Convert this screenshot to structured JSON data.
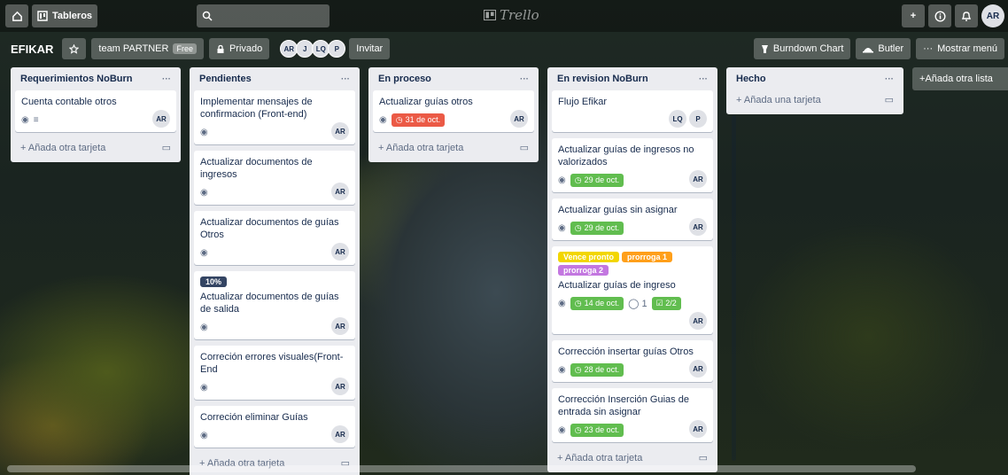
{
  "topbar": {
    "home_icon": "home-icon",
    "boards_label": "Tableros",
    "search_icon": "search-icon",
    "logo_text": "Trello",
    "buttons": [
      "+",
      "ⓘ",
      "🔔"
    ],
    "user_initials": "AR"
  },
  "boardbar": {
    "title": "EFIKAR",
    "team_label": "team PARTNER",
    "free_badge": "Free",
    "privacy_label": "Privado",
    "members": [
      "AR",
      "J",
      "LQ",
      "P"
    ],
    "invite_label": "Invitar",
    "burndown_label": "Burndown Chart",
    "butler_label": "Butler",
    "menu_label": "Mostrar menú"
  },
  "add_card_label": "Añada otra tarjeta",
  "add_card_label_alt": "Añada una tarjeta",
  "add_list_label": "Añada otra lista",
  "lists": [
    {
      "title": "Requerimientos NoBurn",
      "cards": [
        {
          "title": "Cuenta contable otros",
          "members": [
            "AR"
          ],
          "watch": true,
          "desc": true
        }
      ]
    },
    {
      "title": "Pendientes",
      "cards": [
        {
          "title": "Implementar mensajes de confirmacion (Front-end)",
          "members": [
            "AR"
          ],
          "watch": true
        },
        {
          "title": "Actualizar documentos de ingresos",
          "members": [
            "AR"
          ],
          "watch": true
        },
        {
          "title": "Actualizar documentos de guías Otros",
          "members": [
            "AR"
          ],
          "watch": true
        },
        {
          "title": "Actualizar documentos de guías de salida",
          "members": [
            "AR"
          ],
          "watch": true,
          "label": "10%"
        },
        {
          "title": "Correción errores visuales(Front-End",
          "members": [
            "AR"
          ],
          "watch": true
        },
        {
          "title": "Correción eliminar Guías",
          "members": [
            "AR"
          ],
          "watch": true
        }
      ]
    },
    {
      "title": "En proceso",
      "cards": [
        {
          "title": "Actualizar guías otros",
          "members": [
            "AR"
          ],
          "watch": true,
          "due": "31 de oct.",
          "due_color": "#eb5a46"
        }
      ]
    },
    {
      "title": "En revision NoBurn",
      "cards": [
        {
          "title": "Flujo Efikar",
          "members": [
            "LQ",
            "P"
          ]
        },
        {
          "title": "Actualizar guías de ingresos no valorizados",
          "members": [
            "AR"
          ],
          "watch": true,
          "due": "29 de oct."
        },
        {
          "title": "Actualizar guías sin asignar",
          "members": [
            "AR"
          ],
          "watch": true,
          "due": "29 de oct."
        },
        {
          "title": "Actualizar guías de ingreso",
          "members": [
            "AR"
          ],
          "watch": true,
          "due": "14 de oct.",
          "comments": "1",
          "checklist": "2/2",
          "labels": [
            {
              "text": "Vence pronto",
              "color": "#f2d600"
            },
            {
              "text": "prorroga 1",
              "color": "#ff9f1a"
            },
            {
              "text": "prorroga 2",
              "color": "#c377e0"
            }
          ]
        },
        {
          "title": "Corrección insertar guías Otros",
          "members": [
            "AR"
          ],
          "watch": true,
          "due": "28 de oct."
        },
        {
          "title": "Corrección Inserción Guias de entrada sin asignar",
          "members": [
            "AR"
          ],
          "watch": true,
          "due": "23 de oct."
        }
      ]
    },
    {
      "title": "Hecho",
      "cards": []
    }
  ]
}
